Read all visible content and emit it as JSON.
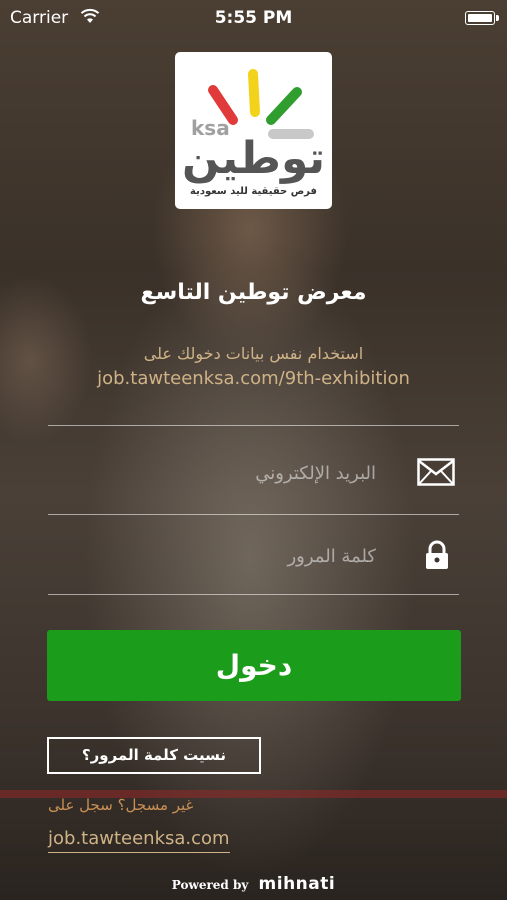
{
  "status_bar": {
    "carrier": "Carrier",
    "time": "5:55 PM"
  },
  "logo": {
    "latin": "ksa",
    "arabic": "توطين",
    "tagline": "فرص حقيقية لليد سعودية"
  },
  "event": {
    "title": "معرض توطين التاسع",
    "subtitle_line1": "استخدام نفس بيانات دخولك على",
    "subtitle_line2": "job.tawteenksa.com/9th-exhibition"
  },
  "form": {
    "email_placeholder": "البريد الإلكتروني",
    "email_value": "",
    "password_placeholder": "كلمة المرور",
    "password_value": "",
    "email_icon": "envelope-icon",
    "password_icon": "lock-icon"
  },
  "buttons": {
    "login": "دخول",
    "forgot_password": "نسيت كلمة المرور؟"
  },
  "register": {
    "text": "غير مسجل؟ سجل على",
    "link": "job.tawteenksa.com"
  },
  "footer": {
    "powered_by": "Powered by",
    "brand": "mihnati"
  },
  "colors": {
    "login_button": "#1b9c1b",
    "accent_text": "#cfb387",
    "register_text": "#c98f55",
    "logo_red": "#e03a3a",
    "logo_yellow": "#f2d21b",
    "logo_green": "#2f9e2f"
  }
}
